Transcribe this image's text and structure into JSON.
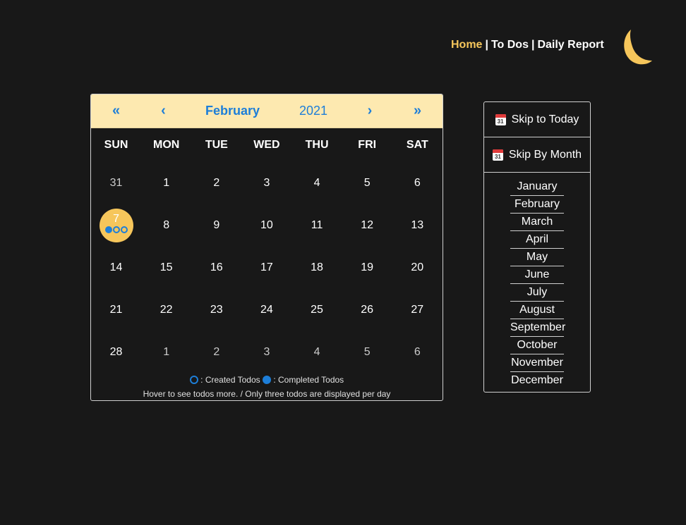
{
  "nav": {
    "home": "Home",
    "sep1": "|",
    "todos": "To Dos",
    "sep2": "|",
    "report": "Daily Report",
    "active": "home",
    "accent_color": "#f6c65b"
  },
  "calendar": {
    "prev_year_icon": "«",
    "prev_month_icon": "‹",
    "month": "February",
    "year": "2021",
    "next_month_icon": "›",
    "next_year_icon": "»",
    "header_bg": "#fde9b0",
    "accent_color": "#1d7ed8",
    "weekdays": [
      "SUN",
      "MON",
      "TUE",
      "WED",
      "THU",
      "FRI",
      "SAT"
    ],
    "weeks": [
      [
        {
          "d": "31",
          "other": true
        },
        {
          "d": "1"
        },
        {
          "d": "2"
        },
        {
          "d": "3"
        },
        {
          "d": "4"
        },
        {
          "d": "5"
        },
        {
          "d": "6"
        }
      ],
      [
        {
          "d": "7",
          "today": true,
          "todos": [
            "completed",
            "created",
            "created"
          ]
        },
        {
          "d": "8"
        },
        {
          "d": "9"
        },
        {
          "d": "10"
        },
        {
          "d": "11"
        },
        {
          "d": "12"
        },
        {
          "d": "13"
        }
      ],
      [
        {
          "d": "14"
        },
        {
          "d": "15"
        },
        {
          "d": "16"
        },
        {
          "d": "17"
        },
        {
          "d": "18"
        },
        {
          "d": "19"
        },
        {
          "d": "20"
        }
      ],
      [
        {
          "d": "21"
        },
        {
          "d": "22"
        },
        {
          "d": "23"
        },
        {
          "d": "24"
        },
        {
          "d": "25"
        },
        {
          "d": "26"
        },
        {
          "d": "27"
        }
      ],
      [
        {
          "d": "28"
        },
        {
          "d": "1",
          "other": true
        },
        {
          "d": "2",
          "other": true
        },
        {
          "d": "3",
          "other": true
        },
        {
          "d": "4",
          "other": true
        },
        {
          "d": "5",
          "other": true
        },
        {
          "d": "6",
          "other": true
        }
      ]
    ],
    "legend_created": ": Created Todos",
    "legend_completed": ": Completed Todos",
    "hint": "Hover to see todos more. / Only three todos are displayed per day"
  },
  "side": {
    "skip_today": "Skip to Today",
    "skip_month": "Skip By Month",
    "icon_day": "31",
    "months": [
      "January",
      "February",
      "March",
      "April",
      "May",
      "June",
      "July",
      "August",
      "September",
      "October",
      "November",
      "December"
    ]
  }
}
